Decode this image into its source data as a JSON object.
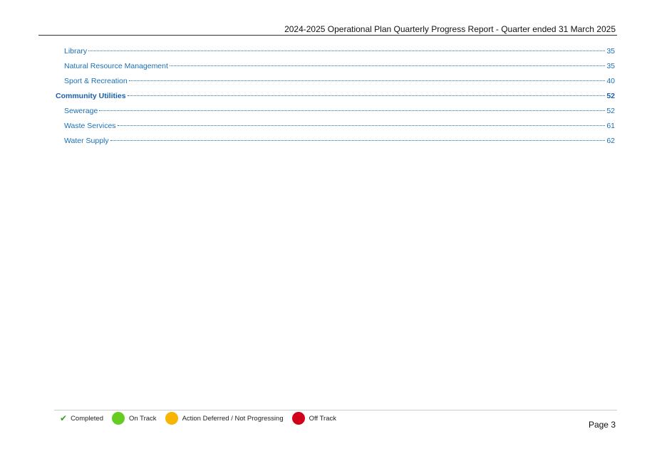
{
  "header": {
    "title": "2024-2025 Operational Plan Quarterly Progress Report - Quarter ended 31 March 2025"
  },
  "toc": {
    "entries": [
      {
        "label": "Library",
        "page": "35"
      },
      {
        "label": "Natural Resource Management",
        "page": "35"
      },
      {
        "label": "Sport & Recreation",
        "page": "40"
      },
      {
        "label": "Community Utilities",
        "page": "52"
      },
      {
        "label": "Sewerage",
        "page": "52"
      },
      {
        "label": "Waste Services",
        "page": "61"
      },
      {
        "label": "Water Supply",
        "page": "62"
      }
    ]
  },
  "legend": {
    "completed": {
      "label": "Completed",
      "icon": "check-icon",
      "color": "#3a9a1f"
    },
    "on_track": {
      "label": "On Track",
      "icon": "green-dot-icon",
      "color": "#66cc22"
    },
    "deferred": {
      "label": "Action Deferred / Not Progressing",
      "icon": "orange-dot-icon",
      "color": "#f7b500"
    },
    "off_track": {
      "label": "Off Track",
      "icon": "red-dot-icon",
      "color": "#d0021b"
    }
  },
  "footer": {
    "page_label": "Page 3"
  }
}
